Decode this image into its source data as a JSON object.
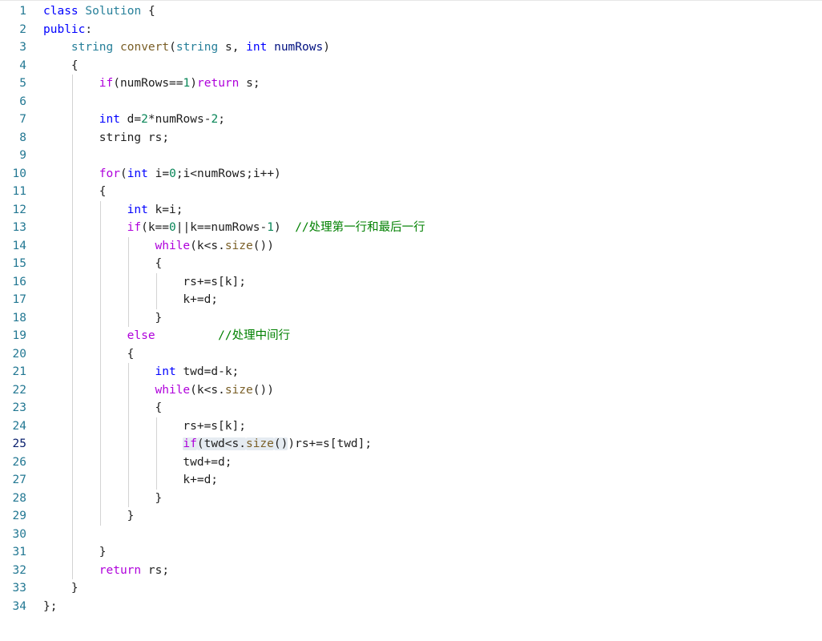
{
  "editor": {
    "language": "cpp",
    "active_line": 25,
    "colors": {
      "line_number": "#237893",
      "keyword": "#0000ff",
      "control": "#af00db",
      "type": "#267f99",
      "function": "#795e26",
      "variable": "#001080",
      "number": "#098658",
      "comment": "#008000"
    },
    "lines": [
      {
        "n": "1",
        "indent": 0,
        "tokens": [
          [
            "kw",
            "class"
          ],
          [
            "p",
            " "
          ],
          [
            "type",
            "Solution"
          ],
          [
            "p",
            " {"
          ]
        ]
      },
      {
        "n": "2",
        "indent": 0,
        "tokens": [
          [
            "kw",
            "public"
          ],
          [
            "p",
            ":"
          ]
        ]
      },
      {
        "n": "3",
        "indent": 1,
        "tokens": [
          [
            "type",
            "string"
          ],
          [
            "p",
            " "
          ],
          [
            "fn",
            "convert"
          ],
          [
            "p",
            "("
          ],
          [
            "type",
            "string"
          ],
          [
            "p",
            " s, "
          ],
          [
            "kw",
            "int"
          ],
          [
            "p",
            " "
          ],
          [
            "var",
            "numRows"
          ],
          [
            "p",
            ")"
          ]
        ]
      },
      {
        "n": "4",
        "indent": 1,
        "tokens": [
          [
            "p",
            "{"
          ]
        ]
      },
      {
        "n": "5",
        "indent": 2,
        "tokens": [
          [
            "ctl",
            "if"
          ],
          [
            "p",
            "(numRows=="
          ],
          [
            "num",
            "1"
          ],
          [
            "p",
            ")"
          ],
          [
            "ctl",
            "return"
          ],
          [
            "p",
            " s;"
          ]
        ]
      },
      {
        "n": "6",
        "indent": 0,
        "tokens": []
      },
      {
        "n": "7",
        "indent": 2,
        "tokens": [
          [
            "kw",
            "int"
          ],
          [
            "p",
            " d="
          ],
          [
            "num",
            "2"
          ],
          [
            "p",
            "*numRows-"
          ],
          [
            "num",
            "2"
          ],
          [
            "p",
            ";"
          ]
        ]
      },
      {
        "n": "8",
        "indent": 2,
        "tokens": [
          [
            "p",
            "string rs;"
          ]
        ]
      },
      {
        "n": "9",
        "indent": 0,
        "tokens": []
      },
      {
        "n": "10",
        "indent": 2,
        "tokens": [
          [
            "ctl",
            "for"
          ],
          [
            "p",
            "("
          ],
          [
            "kw",
            "int"
          ],
          [
            "p",
            " i="
          ],
          [
            "num",
            "0"
          ],
          [
            "p",
            ";i<numRows;i++)"
          ]
        ]
      },
      {
        "n": "11",
        "indent": 2,
        "tokens": [
          [
            "p",
            "{"
          ]
        ]
      },
      {
        "n": "12",
        "indent": 3,
        "tokens": [
          [
            "kw",
            "int"
          ],
          [
            "p",
            " k=i;"
          ]
        ]
      },
      {
        "n": "13",
        "indent": 3,
        "tokens": [
          [
            "ctl",
            "if"
          ],
          [
            "p",
            "(k=="
          ],
          [
            "num",
            "0"
          ],
          [
            "p",
            "||k==numRows-"
          ],
          [
            "num",
            "1"
          ],
          [
            "p",
            ")  "
          ],
          [
            "com",
            "//处理第一行和最后一行"
          ]
        ]
      },
      {
        "n": "14",
        "indent": 4,
        "tokens": [
          [
            "ctl",
            "while"
          ],
          [
            "p",
            "(k<s."
          ],
          [
            "fn",
            "size"
          ],
          [
            "p",
            "())"
          ]
        ]
      },
      {
        "n": "15",
        "indent": 4,
        "tokens": [
          [
            "p",
            "{"
          ]
        ]
      },
      {
        "n": "16",
        "indent": 5,
        "tokens": [
          [
            "p",
            "rs+=s[k];"
          ]
        ]
      },
      {
        "n": "17",
        "indent": 5,
        "tokens": [
          [
            "p",
            "k+=d;"
          ]
        ]
      },
      {
        "n": "18",
        "indent": 4,
        "tokens": [
          [
            "p",
            "}"
          ]
        ]
      },
      {
        "n": "19",
        "indent": 3,
        "tokens": [
          [
            "ctl",
            "else"
          ],
          [
            "p",
            "         "
          ],
          [
            "com",
            "//处理中间行"
          ]
        ]
      },
      {
        "n": "20",
        "indent": 3,
        "tokens": [
          [
            "p",
            "{"
          ]
        ]
      },
      {
        "n": "21",
        "indent": 4,
        "tokens": [
          [
            "kw",
            "int"
          ],
          [
            "p",
            " twd=d-k;"
          ]
        ]
      },
      {
        "n": "22",
        "indent": 4,
        "tokens": [
          [
            "ctl",
            "while"
          ],
          [
            "p",
            "(k<s."
          ],
          [
            "fn",
            "size"
          ],
          [
            "p",
            "())"
          ]
        ]
      },
      {
        "n": "23",
        "indent": 4,
        "tokens": [
          [
            "p",
            "{"
          ]
        ]
      },
      {
        "n": "24",
        "indent": 5,
        "tokens": [
          [
            "p",
            "rs+=s[k];"
          ]
        ]
      },
      {
        "n": "25",
        "indent": 5,
        "tokens": [
          [
            "hl-ctl",
            "if"
          ],
          [
            "hl",
            "(twd<s."
          ],
          [
            "hl-fn",
            "size"
          ],
          [
            "hl",
            "()"
          ],
          [
            "p",
            ")rs+=s[twd];"
          ]
        ]
      },
      {
        "n": "26",
        "indent": 5,
        "tokens": [
          [
            "p",
            "twd+=d;"
          ]
        ]
      },
      {
        "n": "27",
        "indent": 5,
        "tokens": [
          [
            "p",
            "k+=d;"
          ]
        ]
      },
      {
        "n": "28",
        "indent": 4,
        "tokens": [
          [
            "p",
            "}"
          ]
        ]
      },
      {
        "n": "29",
        "indent": 3,
        "tokens": [
          [
            "p",
            "}"
          ]
        ]
      },
      {
        "n": "30",
        "indent": 0,
        "tokens": []
      },
      {
        "n": "31",
        "indent": 2,
        "tokens": [
          [
            "p",
            "}"
          ]
        ]
      },
      {
        "n": "32",
        "indent": 2,
        "tokens": [
          [
            "ctl",
            "return"
          ],
          [
            "p",
            " rs;"
          ]
        ]
      },
      {
        "n": "33",
        "indent": 1,
        "tokens": [
          [
            "p",
            "}"
          ]
        ]
      },
      {
        "n": "34",
        "indent": 0,
        "tokens": [
          [
            "p",
            "};"
          ]
        ]
      }
    ]
  }
}
